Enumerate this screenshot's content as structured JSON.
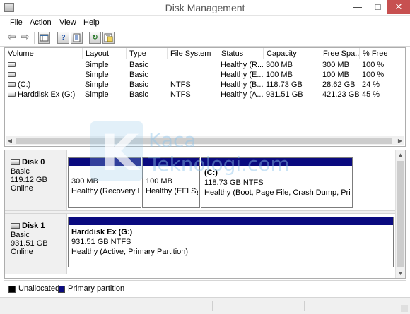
{
  "window": {
    "title": "Disk Management",
    "minimize_glyph": "—",
    "maximize_glyph": "□",
    "close_glyph": "✕"
  },
  "menu": {
    "items": [
      "File",
      "Action",
      "View",
      "Help"
    ]
  },
  "toolbar": {
    "icons": [
      "back-arrow-icon",
      "forward-arrow-icon",
      "show-hide-console-tree-icon",
      "help-icon",
      "properties-icon",
      "refresh-icon",
      "export-list-icon"
    ],
    "back_glyph": "⇦",
    "forward_glyph": "⇨",
    "help_glyph": "?",
    "refresh_glyph": "↻"
  },
  "volume_list": {
    "columns": [
      "Volume",
      "Layout",
      "Type",
      "File System",
      "Status",
      "Capacity",
      "Free Spa...",
      "% Free"
    ],
    "rows": [
      {
        "volume": "",
        "layout": "Simple",
        "type": "Basic",
        "fs": "",
        "status": "Healthy (R...",
        "capacity": "300 MB",
        "free": "300 MB",
        "pct": "100 %"
      },
      {
        "volume": "",
        "layout": "Simple",
        "type": "Basic",
        "fs": "",
        "status": "Healthy (E...",
        "capacity": "100 MB",
        "free": "100 MB",
        "pct": "100 %"
      },
      {
        "volume": "(C:)",
        "layout": "Simple",
        "type": "Basic",
        "fs": "NTFS",
        "status": "Healthy (B...",
        "capacity": "118.73 GB",
        "free": "28.62 GB",
        "pct": "24 %"
      },
      {
        "volume": "Harddisk Ex (G:)",
        "layout": "Simple",
        "type": "Basic",
        "fs": "NTFS",
        "status": "Healthy (A...",
        "capacity": "931.51 GB",
        "free": "421.23 GB",
        "pct": "45 %"
      }
    ]
  },
  "disks": [
    {
      "name": "Disk 0",
      "type": "Basic",
      "size": "119.12 GB",
      "status": "Online",
      "partitions": [
        {
          "label": "",
          "size": "300 MB",
          "status": "Healthy (Recovery Pa"
        },
        {
          "label": "",
          "size": "100 MB",
          "status": "Healthy (EFI Syst"
        },
        {
          "label": "(C:)",
          "size": "118.73 GB NTFS",
          "status": "Healthy (Boot, Page File, Crash Dump, Primary"
        }
      ]
    },
    {
      "name": "Disk 1",
      "type": "Basic",
      "size": "931.51 GB",
      "status": "Online",
      "partitions": [
        {
          "label": "Harddisk Ex  (G:)",
          "size": "931.51 GB NTFS",
          "status": "Healthy (Active, Primary Partition)"
        }
      ]
    }
  ],
  "legend": {
    "items": [
      {
        "label": "Unallocated",
        "color": "#000000"
      },
      {
        "label": "Primary partition",
        "color": "#0a0a7f"
      }
    ]
  },
  "watermark": {
    "letter": "K",
    "line1": "Kaca",
    "line2": "Teknologi.com"
  },
  "colors": {
    "partition_bar": "#0a0a7f",
    "close_button": "#c75050"
  }
}
